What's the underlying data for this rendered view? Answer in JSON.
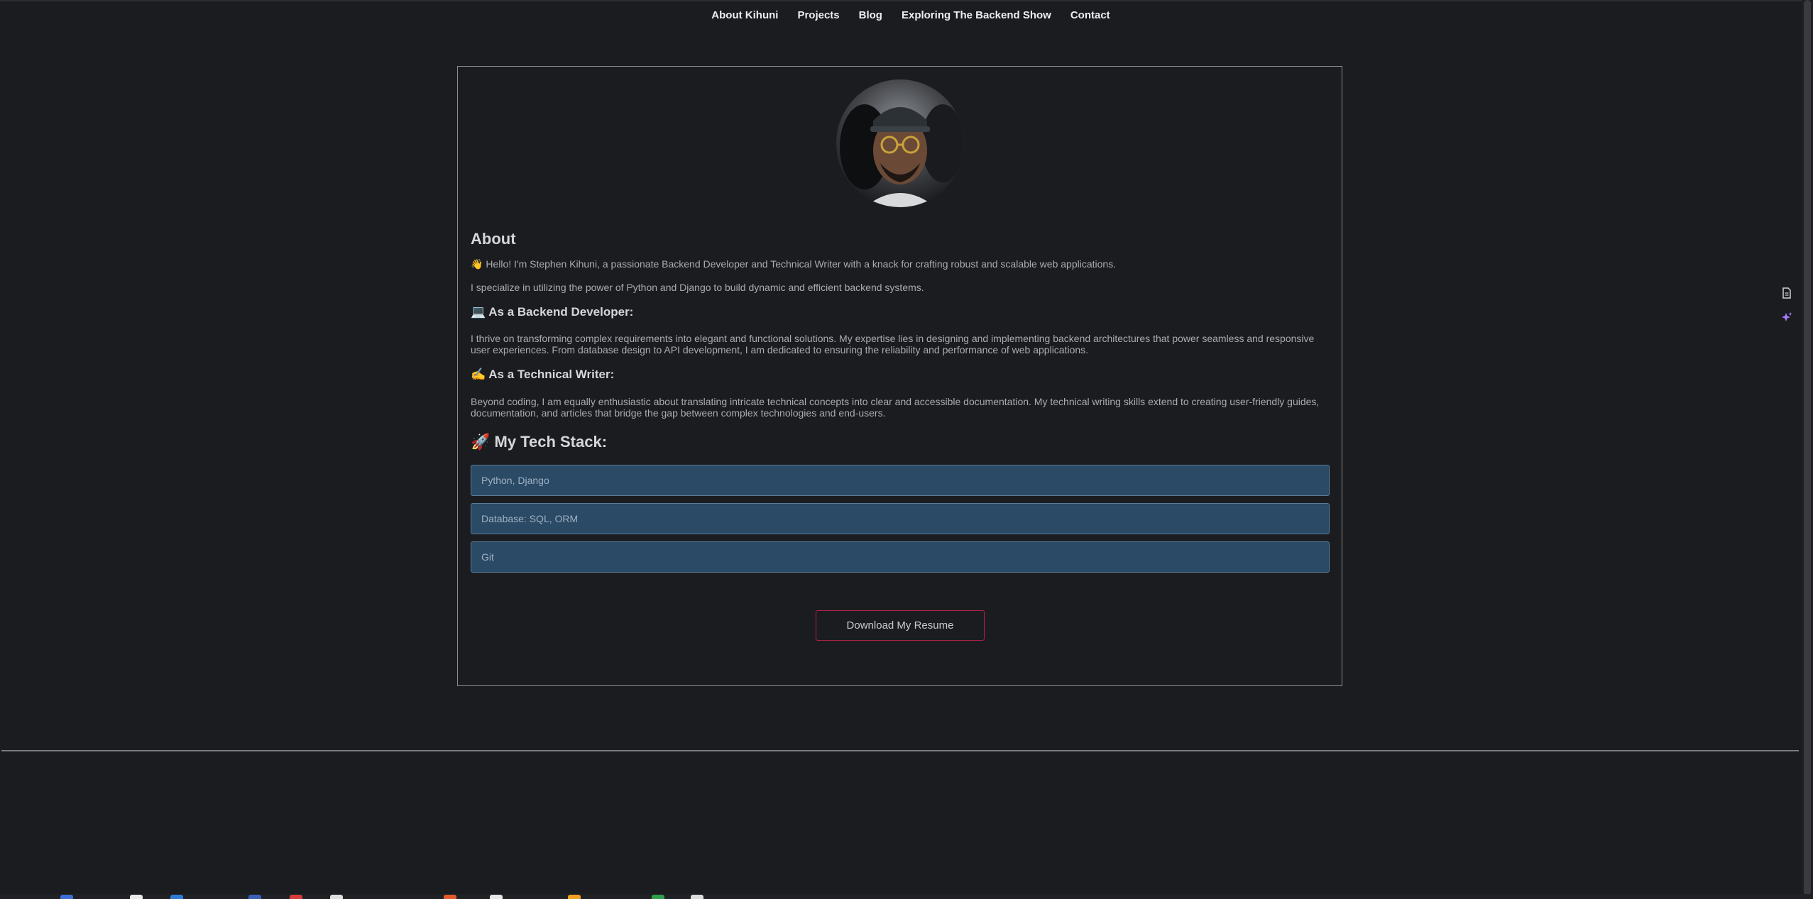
{
  "nav": {
    "items": [
      {
        "label": "About Kihuni"
      },
      {
        "label": "Projects"
      },
      {
        "label": "Blog"
      },
      {
        "label": "Exploring The Backend Show"
      },
      {
        "label": "Contact"
      }
    ]
  },
  "about": {
    "title": "About",
    "intro": "👋 Hello! I'm Stephen Kihuni, a passionate Backend Developer and Technical Writer with a knack for crafting robust and scalable web applications.",
    "specialize": "I specialize in utilizing the power of Python and Django to build dynamic and efficient backend systems.",
    "backend_heading": "💻 As a Backend Developer:",
    "backend_text": "I thrive on transforming complex requirements into elegant and functional solutions. My expertise lies in designing and implementing backend architectures that power seamless and responsive user experiences. From database design to API development, I am dedicated to ensuring the reliability and performance of web applications.",
    "writer_heading": "✍️ As a Technical Writer:",
    "writer_text": "Beyond coding, I am equally enthusiastic about translating intricate technical concepts into clear and accessible documentation. My technical writing skills extend to creating user-friendly guides, documentation, and articles that bridge the gap between complex technologies and end-users.",
    "stack_heading": "🚀 My Tech Stack:",
    "stack": [
      {
        "label": "Python, Django"
      },
      {
        "label": "Database: SQL, ORM"
      },
      {
        "label": "Git"
      }
    ],
    "resume_button": "Download My Resume"
  },
  "side_icons": [
    "document-icon",
    "sparkle-icon"
  ],
  "colors": {
    "background": "#1b1c1f",
    "stack_item_bg": "#2a4a66",
    "button_border": "#b3214a",
    "sparkle": "#a97bff"
  }
}
